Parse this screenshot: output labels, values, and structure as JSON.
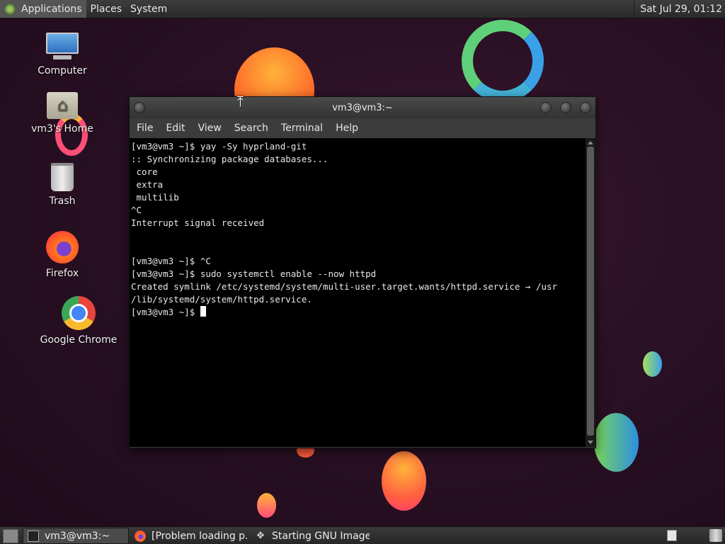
{
  "top_panel": {
    "menus": [
      "Applications",
      "Places",
      "System"
    ],
    "clock": "Sat Jul 29, 01:12"
  },
  "desktop_icons": [
    {
      "label": "Computer",
      "icon": "computer-icon"
    },
    {
      "label": "vm3's Home",
      "icon": "home-folder-icon"
    },
    {
      "label": "Trash",
      "icon": "trash-icon"
    },
    {
      "label": "Firefox",
      "icon": "firefox-icon"
    },
    {
      "label": "Google Chrome",
      "icon": "chrome-icon"
    }
  ],
  "terminal": {
    "title": "vm3@vm3:~",
    "menus": [
      "File",
      "Edit",
      "View",
      "Search",
      "Terminal",
      "Help"
    ],
    "lines": [
      "[vm3@vm3 ~]$ yay -Sy hyprland-git",
      ":: Synchronizing package databases...",
      " core",
      " extra",
      " multilib",
      "^C",
      "Interrupt signal received",
      "",
      "",
      "[vm3@vm3 ~]$ ^C",
      "[vm3@vm3 ~]$ sudo systemctl enable --now httpd",
      "Created symlink /etc/systemd/system/multi-user.target.wants/httpd.service → /usr",
      "/lib/systemd/system/httpd.service.",
      "[vm3@vm3 ~]$ "
    ]
  },
  "taskbar": {
    "tasks": [
      {
        "label": "vm3@vm3:~",
        "icon": "terminal-icon",
        "active": true
      },
      {
        "label": "[Problem loading p...",
        "icon": "firefox-icon",
        "active": false
      },
      {
        "label": "Starting GNU Image...",
        "icon": "gimp-icon",
        "active": false
      }
    ]
  },
  "colors": {
    "terminal_bg": "#000000",
    "terminal_fg": "#e8e8e8",
    "panel_bg": "#2f2f2f",
    "wallpaper": "#2a1024"
  }
}
